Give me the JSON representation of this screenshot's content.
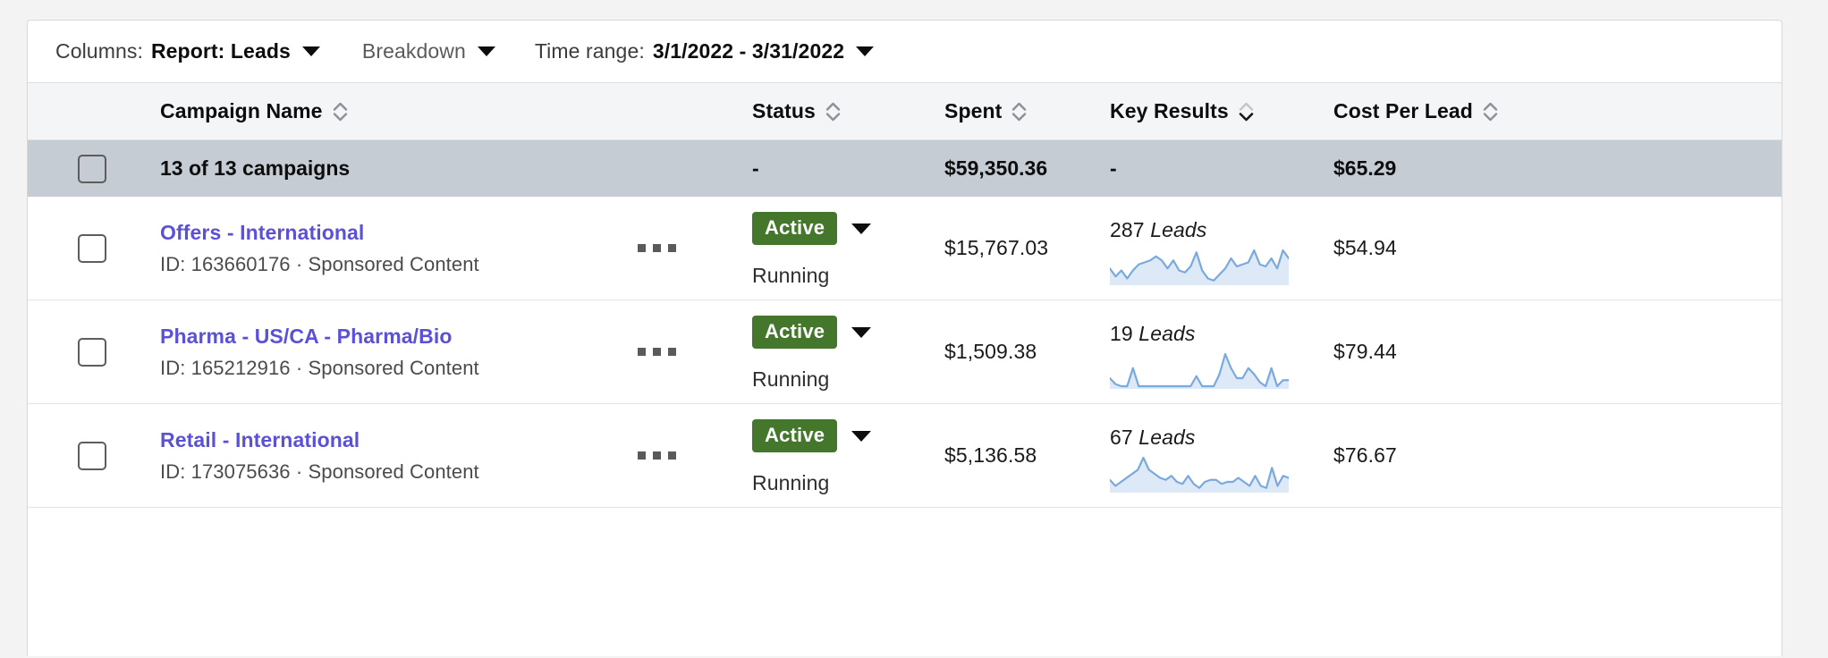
{
  "toolbar": {
    "columns_label": "Columns:",
    "columns_value": "Report: Leads",
    "breakdown_label": "Breakdown",
    "time_range_label": "Time range:",
    "time_range_value": "3/1/2022 - 3/31/2022",
    "caret_icon": "chevron-down-icon"
  },
  "colors": {
    "link": "#5b51d8",
    "badge_active": "#44762c",
    "summary_row": "#c5ccd4",
    "header_row": "#f3f5f7",
    "spark_line": "#7aa9dd",
    "spark_fill": "#dde9f7"
  },
  "table": {
    "columns": [
      {
        "key": "campaign_name",
        "label": "Campaign Name",
        "sort_icon": "sort-updown-icon",
        "sort_state": "none"
      },
      {
        "key": "status",
        "label": "Status",
        "sort_icon": "sort-updown-icon",
        "sort_state": "none"
      },
      {
        "key": "spent",
        "label": "Spent",
        "sort_icon": "sort-updown-icon",
        "sort_state": "none"
      },
      {
        "key": "key_results",
        "label": "Key Results",
        "sort_icon": "sort-updown-icon",
        "sort_state": "desc"
      },
      {
        "key": "cost_per_lead",
        "label": "Cost Per Lead",
        "sort_icon": "sort-updown-icon",
        "sort_state": "none"
      }
    ],
    "summary": {
      "campaign_name": "13 of 13 campaigns",
      "status": "-",
      "spent": "$59,350.36",
      "key_results": "-",
      "cost_per_lead": "$65.29",
      "checkbox_checked": false
    },
    "rows": [
      {
        "campaign_name": "Offers - International",
        "meta": "ID: 163660176 · Sponsored Content",
        "menu_icon": "ellipsis-icon",
        "status_badge": "Active",
        "status_sub": "Running",
        "spent": "$15,767.03",
        "key_results_value": "287",
        "key_results_unit": "Leads",
        "cost_per_lead": "$54.94",
        "checkbox_checked": false,
        "sparkline": [
          7,
          3,
          6,
          2,
          6,
          9,
          10,
          11,
          13,
          11,
          7,
          11,
          6,
          5,
          8,
          15,
          6,
          2,
          1,
          4,
          7,
          12,
          8,
          9,
          10,
          16,
          9,
          8,
          12,
          7,
          16,
          12
        ]
      },
      {
        "campaign_name": "Pharma - US/CA - Pharma/Bio",
        "meta": "ID: 165212916 · Sponsored Content",
        "menu_icon": "ellipsis-icon",
        "status_badge": "Active",
        "status_sub": "Running",
        "spent": "$1,509.38",
        "key_results_value": "19",
        "key_results_unit": "Leads",
        "cost_per_lead": "$79.44",
        "checkbox_checked": false,
        "sparkline": [
          4,
          1,
          0,
          0,
          9,
          0,
          0,
          0,
          0,
          0,
          0,
          0,
          0,
          0,
          0,
          5,
          0,
          0,
          0,
          6,
          16,
          9,
          4,
          4,
          9,
          6,
          2,
          0,
          9,
          0,
          3,
          3
        ]
      },
      {
        "campaign_name": "Retail - International",
        "meta": "ID: 173075636 · Sponsored Content",
        "menu_icon": "ellipsis-icon",
        "status_badge": "Active",
        "status_sub": "Running",
        "spent": "$5,136.58",
        "key_results_value": "67",
        "key_results_unit": "Leads",
        "cost_per_lead": "$76.67",
        "checkbox_checked": false,
        "sparkline": [
          5,
          2,
          4,
          6,
          8,
          10,
          16,
          10,
          8,
          6,
          5,
          7,
          4,
          3,
          7,
          3,
          1,
          4,
          5,
          5,
          3,
          4,
          4,
          6,
          4,
          2,
          7,
          2,
          1,
          11,
          2,
          7,
          6
        ]
      }
    ]
  }
}
